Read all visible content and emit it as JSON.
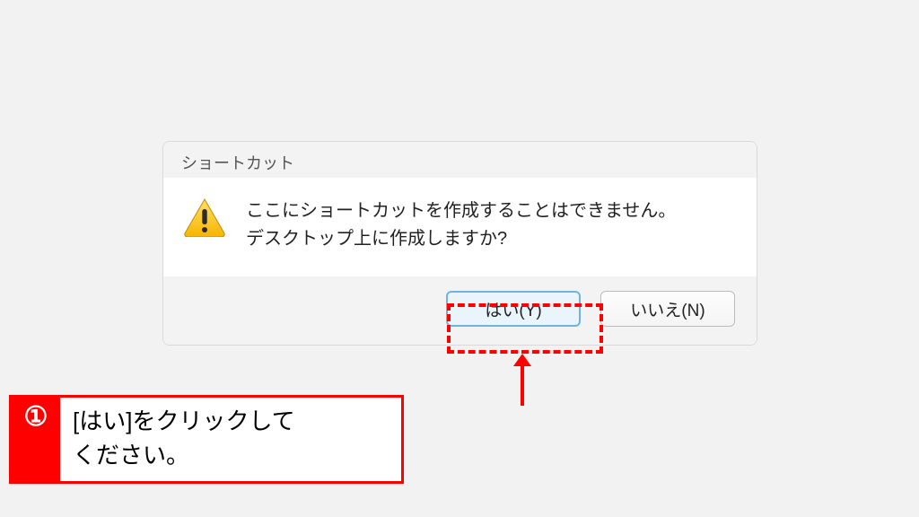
{
  "dialog": {
    "title": "ショートカット",
    "message_line1": "ここにショートカットを作成することはできません。",
    "message_line2": "デスクトップ上に作成しますか?",
    "icon": "warning-icon",
    "yes_label": "はい(Y)",
    "no_label": "いいえ(N)"
  },
  "callout": {
    "step_number": "①",
    "instruction_text": "[はい]をクリックして\nください。",
    "highlight_color": "#ff0000"
  }
}
